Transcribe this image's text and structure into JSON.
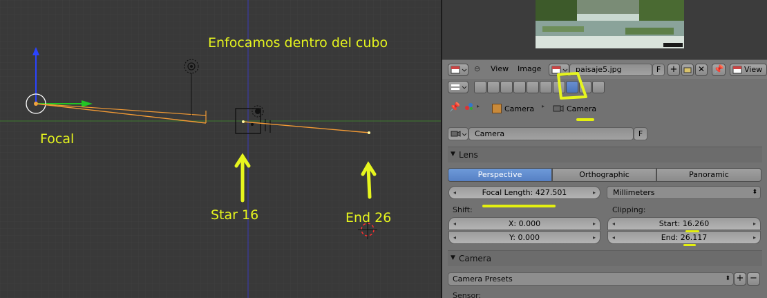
{
  "viewport": {
    "annotations": {
      "title": "Enfocamos dentro del cubo",
      "focal": "Focal",
      "start": "Star 16",
      "end": "End 26"
    }
  },
  "image_header": {
    "menu_view": "View",
    "menu_image": "Image",
    "image_name": "paisaje5.jpg",
    "fake_user": "F",
    "view_label": "View"
  },
  "breadcrumb": {
    "object": "Camera",
    "data": "Camera"
  },
  "datablock": {
    "name": "Camera",
    "fake_user": "F"
  },
  "lens": {
    "header": "Lens",
    "modes": [
      "Perspective",
      "Orthographic",
      "Panoramic"
    ],
    "active_mode": "Perspective",
    "focal_length": "Focal Length: 427.501",
    "units": "Millimeters",
    "shift_label": "Shift:",
    "shift_x": "X: 0.000",
    "shift_y": "Y: 0.000",
    "clipping_label": "Clipping:",
    "clip_start": "Start: 16.260",
    "clip_end": "End: 26.117"
  },
  "camera_panel": {
    "header": "Camera",
    "presets": "Camera Presets",
    "sensor_label": "Sensor:"
  },
  "colors": {
    "annotation": "#e6f51e",
    "active_blue": "#5a86c8",
    "panel_bg": "#727272",
    "viewport_bg": "#393939"
  }
}
